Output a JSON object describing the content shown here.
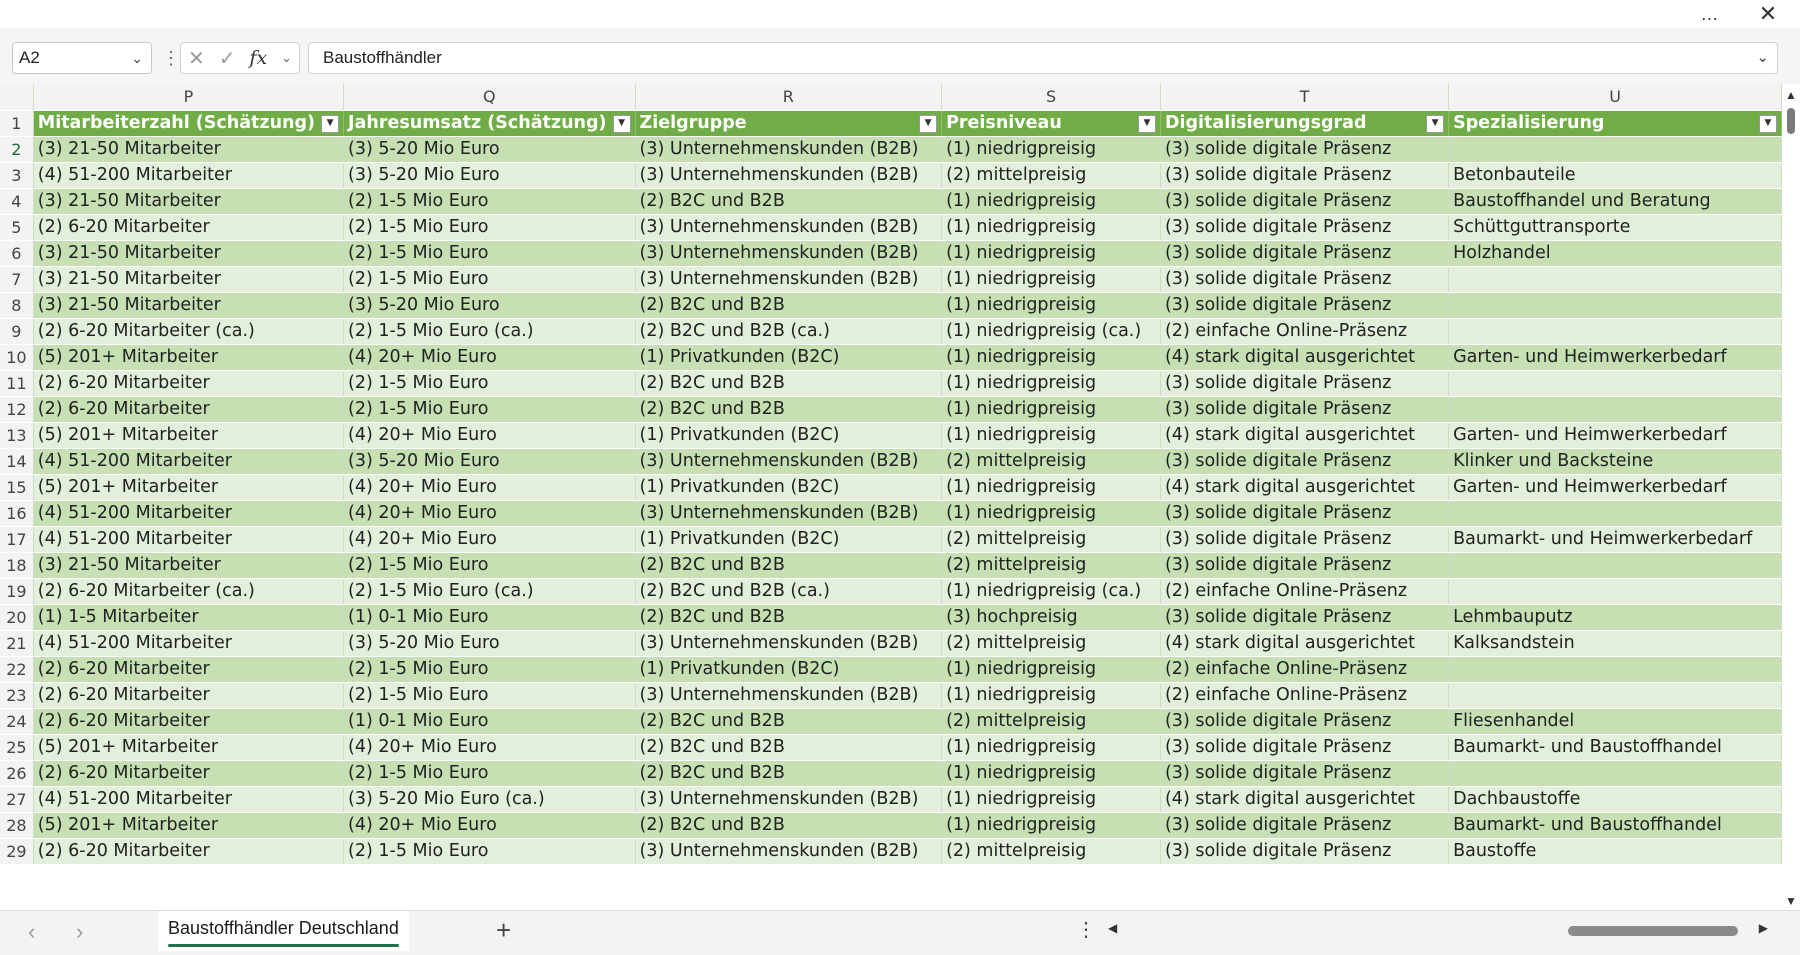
{
  "window": {
    "more_icon": "…",
    "close_icon": "✕"
  },
  "formula_bar": {
    "name_box": "A2",
    "cancel_icon": "✕",
    "enter_icon": "✓",
    "function_icon": "fx",
    "formula_text": "Baustoffhändler"
  },
  "columns": [
    "P",
    "Q",
    "R",
    "S",
    "T",
    "U"
  ],
  "table_headers": [
    "Mitarbeiterzahl (Schätzung)",
    "Jahresumsatz (Schätzung)",
    "Zielgruppe",
    "Preisniveau",
    "Digitalisierungsgrad",
    "Spezialisierung"
  ],
  "rows": [
    {
      "num": "2",
      "cells": [
        "(3) 21-50 Mitarbeiter",
        "(3) 5-20 Mio Euro",
        "(3) Unternehmenskunden (B2B)",
        "(1) niedrigpreisig",
        "(3) solide digitale Präsenz",
        ""
      ]
    },
    {
      "num": "3",
      "cells": [
        "(4) 51-200 Mitarbeiter",
        "(3) 5-20 Mio Euro",
        "(3) Unternehmenskunden (B2B)",
        "(2) mittelpreisig",
        "(3) solide digitale Präsenz",
        "Betonbauteile"
      ]
    },
    {
      "num": "4",
      "cells": [
        "(3) 21-50 Mitarbeiter",
        "(2) 1-5 Mio Euro",
        "(2) B2C und B2B",
        "(1) niedrigpreisig",
        "(3) solide digitale Präsenz",
        "Baustoffhandel und Beratung"
      ]
    },
    {
      "num": "5",
      "cells": [
        "(2) 6-20 Mitarbeiter",
        "(2) 1-5 Mio Euro",
        "(3) Unternehmenskunden (B2B)",
        "(1) niedrigpreisig",
        "(3) solide digitale Präsenz",
        "Schüttguttransporte"
      ]
    },
    {
      "num": "6",
      "cells": [
        "(3) 21-50 Mitarbeiter",
        "(2) 1-5 Mio Euro",
        "(3) Unternehmenskunden (B2B)",
        "(1) niedrigpreisig",
        "(3) solide digitale Präsenz",
        "Holzhandel"
      ]
    },
    {
      "num": "7",
      "cells": [
        "(3) 21-50 Mitarbeiter",
        "(2) 1-5 Mio Euro",
        "(3) Unternehmenskunden (B2B)",
        "(1) niedrigpreisig",
        "(3) solide digitale Präsenz",
        ""
      ]
    },
    {
      "num": "8",
      "cells": [
        "(3) 21-50 Mitarbeiter",
        "(3) 5-20 Mio Euro",
        "(2) B2C und B2B",
        "(1) niedrigpreisig",
        "(3) solide digitale Präsenz",
        ""
      ]
    },
    {
      "num": "9",
      "cells": [
        "(2) 6-20 Mitarbeiter (ca.)",
        "(2) 1-5 Mio Euro (ca.)",
        "(2) B2C und B2B (ca.)",
        "(1) niedrigpreisig (ca.)",
        "(2) einfache Online-Präsenz",
        ""
      ]
    },
    {
      "num": "10",
      "cells": [
        "(5) 201+ Mitarbeiter",
        "(4) 20+ Mio Euro",
        "(1) Privatkunden (B2C)",
        "(1) niedrigpreisig",
        "(4) stark digital ausgerichtet",
        "Garten- und Heimwerkerbedarf"
      ]
    },
    {
      "num": "11",
      "cells": [
        "(2) 6-20 Mitarbeiter",
        "(2) 1-5 Mio Euro",
        "(2) B2C und B2B",
        "(1) niedrigpreisig",
        "(3) solide digitale Präsenz",
        ""
      ]
    },
    {
      "num": "12",
      "cells": [
        "(2) 6-20 Mitarbeiter",
        "(2) 1-5 Mio Euro",
        "(2) B2C und B2B",
        "(1) niedrigpreisig",
        "(3) solide digitale Präsenz",
        ""
      ]
    },
    {
      "num": "13",
      "cells": [
        "(5) 201+ Mitarbeiter",
        "(4) 20+ Mio Euro",
        "(1) Privatkunden (B2C)",
        "(1) niedrigpreisig",
        "(4) stark digital ausgerichtet",
        "Garten- und Heimwerkerbedarf"
      ]
    },
    {
      "num": "14",
      "cells": [
        "(4) 51-200 Mitarbeiter",
        "(3) 5-20 Mio Euro",
        "(3) Unternehmenskunden (B2B)",
        "(2) mittelpreisig",
        "(3) solide digitale Präsenz",
        "Klinker und Backsteine"
      ]
    },
    {
      "num": "15",
      "cells": [
        "(5) 201+ Mitarbeiter",
        "(4) 20+ Mio Euro",
        "(1) Privatkunden (B2C)",
        "(1) niedrigpreisig",
        "(4) stark digital ausgerichtet",
        "Garten- und Heimwerkerbedarf"
      ]
    },
    {
      "num": "16",
      "cells": [
        "(4) 51-200 Mitarbeiter",
        "(4) 20+ Mio Euro",
        "(3) Unternehmenskunden (B2B)",
        "(1) niedrigpreisig",
        "(3) solide digitale Präsenz",
        ""
      ]
    },
    {
      "num": "17",
      "cells": [
        "(4) 51-200 Mitarbeiter",
        "(4) 20+ Mio Euro",
        "(1) Privatkunden (B2C)",
        "(2) mittelpreisig",
        "(3) solide digitale Präsenz",
        "Baumarkt- und Heimwerkerbedarf"
      ]
    },
    {
      "num": "18",
      "cells": [
        "(3) 21-50 Mitarbeiter",
        "(2) 1-5 Mio Euro",
        "(2) B2C und B2B",
        "(2) mittelpreisig",
        "(3) solide digitale Präsenz",
        ""
      ]
    },
    {
      "num": "19",
      "cells": [
        "(2) 6-20 Mitarbeiter (ca.)",
        "(2) 1-5 Mio Euro (ca.)",
        "(2) B2C und B2B (ca.)",
        "(1) niedrigpreisig (ca.)",
        "(2) einfache Online-Präsenz",
        ""
      ]
    },
    {
      "num": "20",
      "cells": [
        "(1) 1-5 Mitarbeiter",
        "(1) 0-1 Mio Euro",
        "(2) B2C und B2B",
        "(3) hochpreisig",
        "(3) solide digitale Präsenz",
        "Lehmbauputz"
      ]
    },
    {
      "num": "21",
      "cells": [
        "(4) 51-200 Mitarbeiter",
        "(3) 5-20 Mio Euro",
        "(3) Unternehmenskunden (B2B)",
        "(2) mittelpreisig",
        "(4) stark digital ausgerichtet",
        "Kalksandstein"
      ]
    },
    {
      "num": "22",
      "cells": [
        "(2) 6-20 Mitarbeiter",
        "(2) 1-5 Mio Euro",
        "(1) Privatkunden (B2C)",
        "(1) niedrigpreisig",
        "(2) einfache Online-Präsenz",
        ""
      ]
    },
    {
      "num": "23",
      "cells": [
        "(2) 6-20 Mitarbeiter",
        "(2) 1-5 Mio Euro",
        "(3) Unternehmenskunden (B2B)",
        "(1) niedrigpreisig",
        "(2) einfache Online-Präsenz",
        ""
      ]
    },
    {
      "num": "24",
      "cells": [
        "(2) 6-20 Mitarbeiter",
        "(1) 0-1 Mio Euro",
        "(2) B2C und B2B",
        "(2) mittelpreisig",
        "(3) solide digitale Präsenz",
        "Fliesenhandel"
      ]
    },
    {
      "num": "25",
      "cells": [
        "(5) 201+ Mitarbeiter",
        "(4) 20+ Mio Euro",
        "(2) B2C und B2B",
        "(1) niedrigpreisig",
        "(3) solide digitale Präsenz",
        "Baumarkt- und Baustoffhandel"
      ]
    },
    {
      "num": "26",
      "cells": [
        "(2) 6-20 Mitarbeiter",
        "(2) 1-5 Mio Euro",
        "(2) B2C und B2B",
        "(1) niedrigpreisig",
        "(3) solide digitale Präsenz",
        ""
      ]
    },
    {
      "num": "27",
      "cells": [
        "(4) 51-200 Mitarbeiter",
        "(3) 5-20 Mio Euro (ca.)",
        "(3) Unternehmenskunden (B2B)",
        "(1) niedrigpreisig",
        "(4) stark digital ausgerichtet",
        "Dachbaustoffe"
      ]
    },
    {
      "num": "28",
      "cells": [
        "(5) 201+ Mitarbeiter",
        "(4) 20+ Mio Euro",
        "(2) B2C und B2B",
        "(1) niedrigpreisig",
        "(3) solide digitale Präsenz",
        "Baumarkt- und Baustoffhandel"
      ]
    },
    {
      "num": "29",
      "cells": [
        "(2) 6-20 Mitarbeiter",
        "(2) 1-5 Mio Euro",
        "(3) Unternehmenskunden (B2B)",
        "(2) mittelpreisig",
        "(3) solide digitale Präsenz",
        "Baustoffe"
      ]
    }
  ],
  "sheet_tabs": {
    "active": "Baustoffhändler Deutschland",
    "add_icon": "+"
  },
  "colors": {
    "header_green": "#70ad47",
    "band_dark": "#c6e0b4",
    "band_light": "#e2efda",
    "accent": "#217346"
  }
}
